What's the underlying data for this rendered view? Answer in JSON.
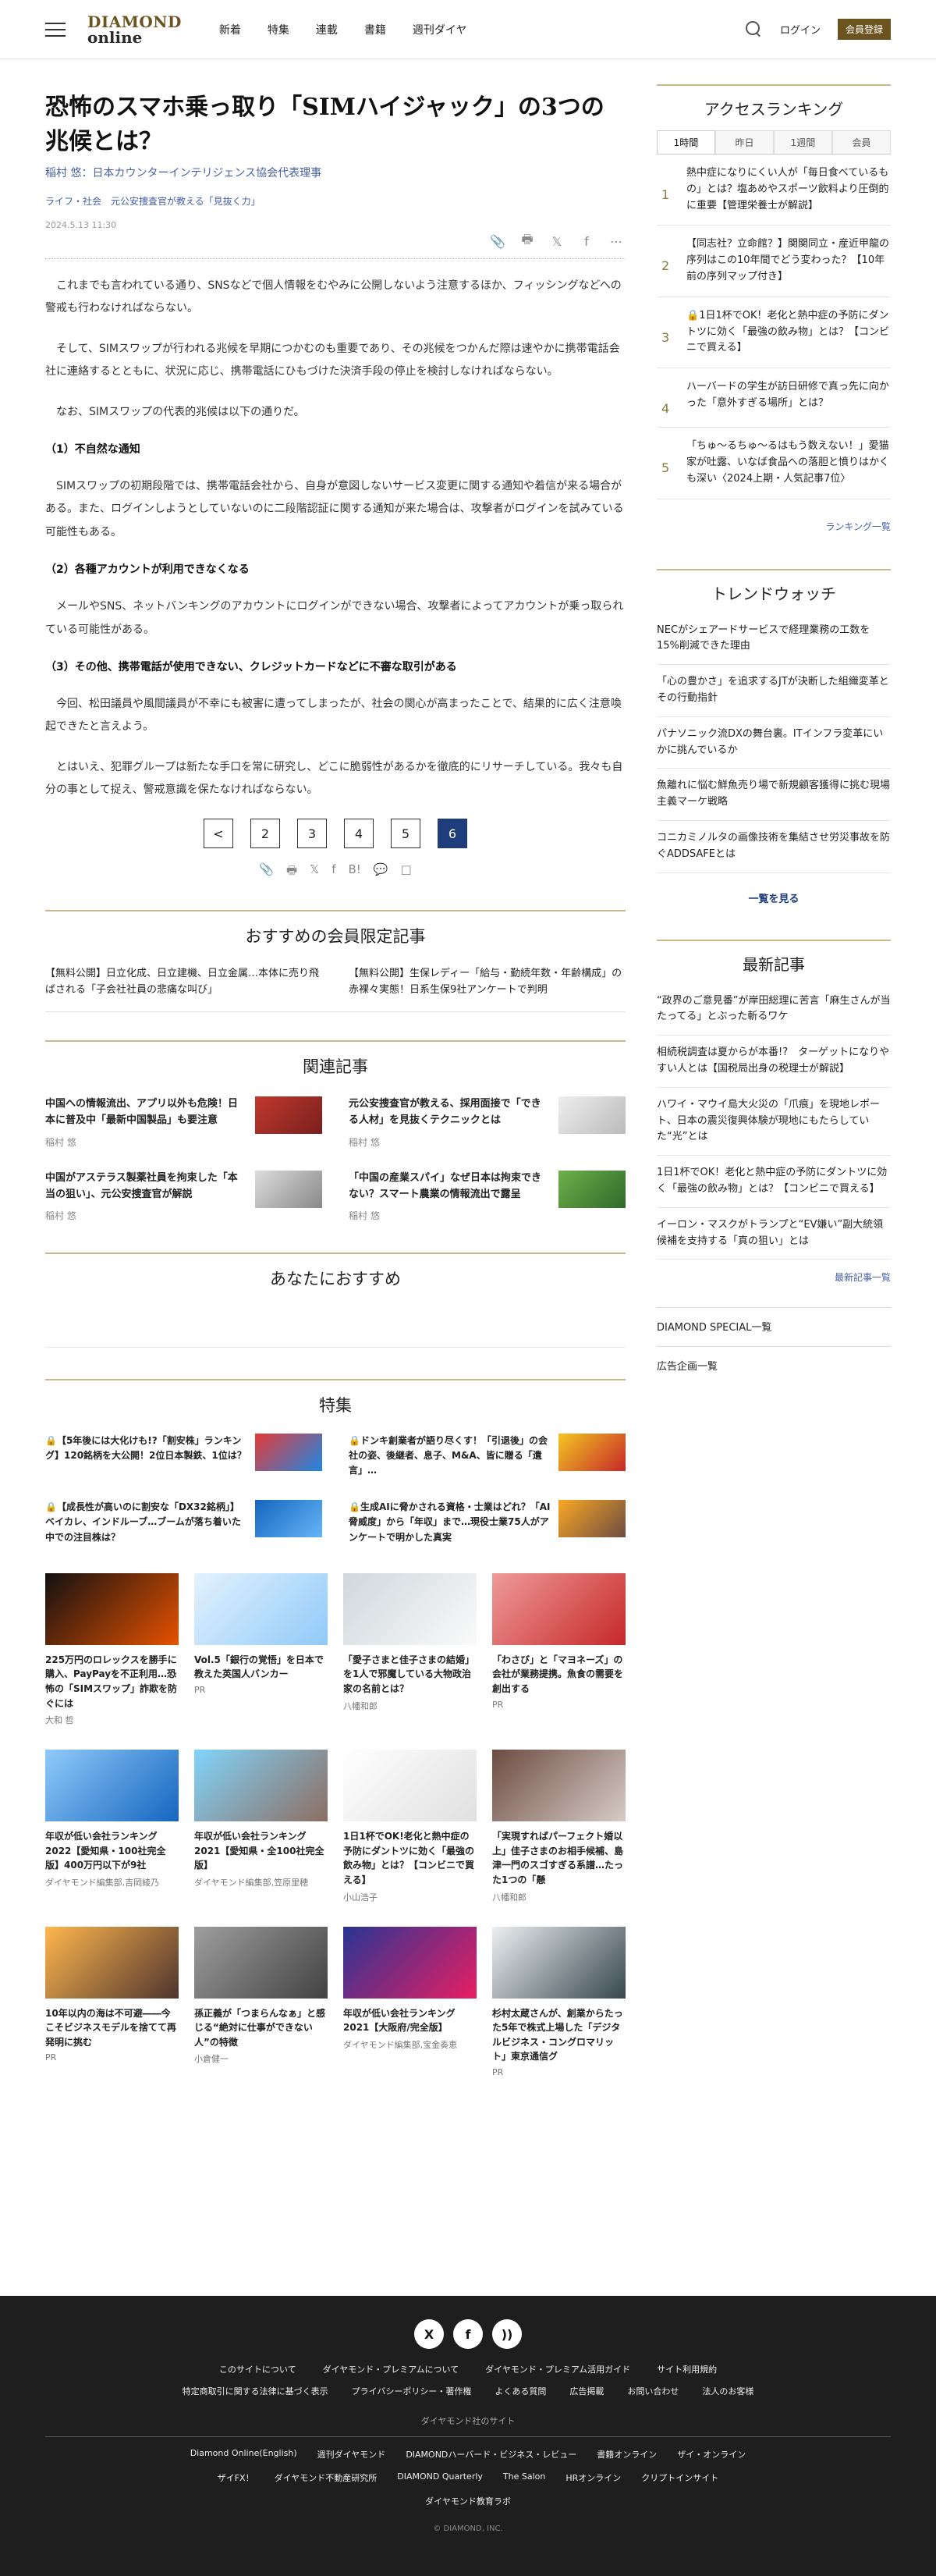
{
  "header": {
    "logo_top": "DIAMOND",
    "logo_bottom": "online",
    "nav": [
      "新着",
      "特集",
      "連載",
      "書籍",
      "週刊ダイヤ"
    ],
    "login": "ログイン",
    "register": "会員登録"
  },
  "article": {
    "title": "恐怖のスマホ乗っ取り「SIMハイジャック」の3つの兆候とは？",
    "author": "稲村 悠：日本カウンターインテリジェンス協会代表理事",
    "category": "ライフ・社会　元公安捜査官が教える「見抜く力」",
    "date": "2024.5.13 11:30",
    "paragraphs": [
      "これまでも言われている通り、SNSなどで個人情報をむやみに公開しないよう注意するほか、フィッシングなどへの警戒も行わなければならない。",
      "そして、SIMスワップが行われる兆候を早期につかむのも重要であり、その兆候をつかんだ際は速やかに携帯電話会社に連絡するとともに、状況に応じ、携帯電話にひもづけた決済手段の停止を検討しなければならない。",
      "なお、SIMスワップの代表的兆候は以下の通りだ。"
    ],
    "h1": "（1）不自然な通知",
    "p1": "SIMスワップの初期段階では、携帯電話会社から、自身が意図しないサービス変更に関する通知や着信が来る場合がある。また、ログインしようとしていないのに二段階認証に関する通知が来た場合は、攻撃者がログインを試みている可能性もある。",
    "h2": "（2）各種アカウントが利用できなくなる",
    "p2": "メールやSNS、ネットバンキングのアカウントにログインができない場合、攻撃者によってアカウントが乗っ取られている可能性がある。",
    "h3": "（3）その他、携帯電話が使用できない、クレジットカードなどに不審な取引がある",
    "p3": "今回、松田議員や風間議員が不幸にも被害に遭ってしまったが、社会の関心が高まったことで、結果的に広く注意喚起できたと言えよう。",
    "p4": "とはいえ、犯罪グループは新たな手口を常に研究し、どこに脆弱性があるかを徹底的にリサーチしている。我々も自分の事として捉え、警戒意識を保たなければならない。"
  },
  "pager": [
    "2",
    "3",
    "4",
    "5",
    "6"
  ],
  "pager_prev": "<",
  "premium": {
    "title": "おすすめの会員限定記事",
    "items": [
      "【無料公開】日立化成、日立建機、日立金属…本体に売り飛ばされる「子会社社員の悲痛な叫び」",
      "【無料公開】生保レディー「給与・勤続年数・年齢構成」の赤裸々実態！日系生保9社アンケートで判明"
    ]
  },
  "related": {
    "title": "関連記事",
    "items": [
      {
        "title": "中国への情報流出、アプリ以外も危険！日本に普及中「最新中国製品」も要注意",
        "author": "稲村 悠"
      },
      {
        "title": "元公安捜査官が教える、採用面接で「できる人材」を見抜くテクニックとは",
        "author": "稲村 悠"
      },
      {
        "title": "中国がアステラス製薬社員を拘束した「本当の狙い」、元公安捜査官が解説",
        "author": "稲村 悠"
      },
      {
        "title": "「中国の産業スパイ」なぜ日本は拘束できない？スマート農業の情報流出で露呈",
        "author": "稲村 悠"
      }
    ]
  },
  "recommend": {
    "title": "あなたにおすすめ"
  },
  "tokushu": {
    "title": "特集",
    "items": [
      "【5年後には大化けも!?「割安株」ランキング】120銘柄を大公開！2位日本製鉄、1位は？",
      "ドンキ創業者が語り尽くす！「引退後」の会社の姿、後継者、息子、M&A、皆に贈る「遺言」…",
      "【成長性が高いのに割安な「DX32銘柄」】ベイカレ、インドルーブ…ブームが落ち着いた中での注目株は？",
      "生成AIに脅かされる資格・士業はどれ？「AI脅威度」から「年収」まで…現役士業75人がアンケートで明かした真実"
    ]
  },
  "cards": [
    {
      "title": "225万円のロレックスを勝手に購入、PayPayを不正利用…恐怖の「SIMスワップ」詐欺を防ぐには",
      "author": "大和 哲"
    },
    {
      "title": "Vol.5「銀行の覚悟」を日本で教えた英国人バンカー",
      "author": "PR"
    },
    {
      "title": "「愛子さまと佳子さまの結婚」を1人で邪魔している大物政治家の名前とは？",
      "author": "八幡和郎"
    },
    {
      "title": "「わさび」と「マヨネーズ」の会社が業務提携。魚食の需要を創出する",
      "author": "PR"
    },
    {
      "title": "年収が低い会社ランキング2022【愛知県・100社完全版】400万円以下が9社",
      "author": "ダイヤモンド編集部,吉岡綾乃"
    },
    {
      "title": "年収が低い会社ランキング2021【愛知県・全100社完全版】",
      "author": "ダイヤモンド編集部,笠原里穂"
    },
    {
      "title": "1日1杯でOK!老化と熱中症の予防にダントツに効く「最強の飲み物」とは？【コンビニで買える】",
      "author": "小山浩子"
    },
    {
      "title": "「実現すればパーフェクト婚以上」佳子さまのお相手候補、島津一門のスゴすぎる系譜…たった1つの「懸",
      "author": "八幡和郎"
    },
    {
      "title": "10年以内の海は不可避――今こそビジネスモデルを捨てて再発明に挑む",
      "author": "PR"
    },
    {
      "title": "孫正義が「つまらんなぁ」と感じる“絶対に仕事ができない人”の特徴",
      "author": "小倉健一"
    },
    {
      "title": "年収が低い会社ランキング2021【大阪府/完全版】",
      "author": "ダイヤモンド編集部,宝金奏恵"
    },
    {
      "title": "杉村太蔵さんが、創業からたった5年で株式上場した「デジタルビジネス・コングロマリット」東京通信グ",
      "author": "PR"
    }
  ],
  "sidebar": {
    "ranking_title": "アクセスランキング",
    "tabs": [
      "1時間",
      "昨日",
      "1週間",
      "会員"
    ],
    "ranking": [
      {
        "n": "1",
        "title": "熱中症になりにくい人が「毎日食べているもの」とは？塩あめやスポーツ飲料より圧倒的に重要【管理栄養士が解説】"
      },
      {
        "n": "2",
        "title": "【同志社？立命館？】関関同立・産近甲龍の序列はこの10年間でどう変わった？【10年前の序列マップ付き】"
      },
      {
        "n": "3",
        "title": "1日1杯でOK！老化と熱中症の予防にダントツに効く「最強の飲み物」とは？【コンビニで買える】"
      },
      {
        "n": "4",
        "title": "ハーバードの学生が訪日研修で真っ先に向かった「意外すぎる場所」とは？"
      },
      {
        "n": "5",
        "title": "「ちゅ～るちゅ～るはもう数えない！」愛猫家が吐露、いなば食品への落胆と憤りはかくも深い〈2024上期・人気記事7位〉"
      }
    ],
    "ranking_more": "ランキング一覧",
    "trend_title": "トレンドウォッチ",
    "trend": [
      "NECがシェアードサービスで経理業務の工数を15%削減できた理由",
      "「心の豊かさ」を追求するJTが決断した組織変革とその行動指針",
      "パナソニック流DXの舞台裏。ITインフラ変革にいかに挑んでいるか",
      "魚離れに悩む鮮魚売り場で新規顧客獲得に挑む現場主義マーケ戦略",
      "コニカミノルタの画像技術を集結させ労災事故を防ぐADDSAFEとは"
    ],
    "trend_more": "一覧を見る",
    "latest_title": "最新記事",
    "latest": [
      "“政界のご意見番”が岸田総理に苦言「麻生さんが当たってる」とぶった斬るワケ",
      "相続税調査は夏からが本番!?　ターゲットになりやすい人とは【国税局出身の税理士が解説】",
      "ハワイ・マウイ島大火災の「爪痕」を現地レポート、日本の震災復興体験が現地にもたらしていた“光”とは",
      "1日1杯でOK！老化と熱中症の予防にダントツに効く「最強の飲み物」とは？【コンビニで買える】",
      "イーロン・マスクがトランプと“EV嫌い”副大統領候補を支持する「真の狙い」とは"
    ],
    "latest_more": "最新記事一覧",
    "special": "DIAMOND SPECIAL一覧",
    "ad": "広告企画一覧"
  },
  "footer": {
    "social": [
      "X",
      "f",
      "))"
    ],
    "row1": [
      "このサイトについて",
      "ダイヤモンド・プレミアムについて",
      "ダイヤモンド・プレミアム活用ガイド",
      "サイト利用規約"
    ],
    "row2": [
      "特定商取引に関する法律に基づく表示",
      "プライバシーポリシー・著作権",
      "よくある質問",
      "広告掲載",
      "お問い合わせ",
      "法人のお客様"
    ],
    "sites_title": "ダイヤモンド社のサイト",
    "sites1": [
      "Diamond Online(English)",
      "週刊ダイヤモンド",
      "DIAMONDハーバード・ビジネス・レビュー",
      "書籍オンライン",
      "ザイ・オンライン"
    ],
    "sites2": [
      "ザイFX！",
      "ダイヤモンド不動産研究所",
      "DIAMOND Quarterly",
      "The Salon",
      "HRオンライン",
      "クリプトインサイト"
    ],
    "sites3": [
      "ダイヤモンド教育ラボ"
    ],
    "copyright": "© DIAMOND, INC."
  }
}
